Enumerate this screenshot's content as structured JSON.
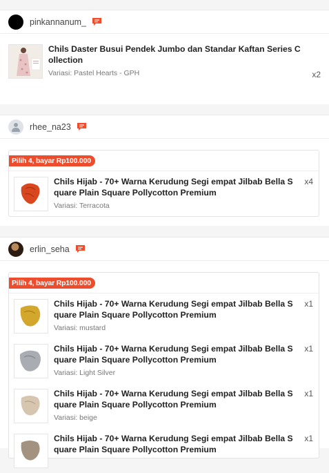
{
  "orders": [
    {
      "username": "pinkannanum_",
      "items": [
        {
          "name": "Chils Daster Busui Pendek Jumbo dan Standar Kaftan Series Collection",
          "variation": "Variasi: Pastel Hearts - GPH",
          "qty": "x2"
        }
      ]
    },
    {
      "username": "rhee_na23",
      "promo": "Pilih 4, bayar Rp100.000",
      "items": [
        {
          "name": "Chils Hijab - 70+ Warna Kerudung Segi empat Jilbab Bella Square Plain Square Pollycotton Premium",
          "variation": "Variasi: Terracota",
          "qty": "x4"
        }
      ]
    },
    {
      "username": "erlin_seha",
      "promo": "Pilih 4, bayar Rp100.000",
      "items": [
        {
          "name": "Chils Hijab - 70+ Warna Kerudung Segi empat Jilbab Bella Square Plain Square Pollycotton Premium",
          "variation": "Variasi: mustard",
          "qty": "x1"
        },
        {
          "name": "Chils Hijab - 70+ Warna Kerudung Segi empat Jilbab Bella Square Plain Square Pollycotton Premium",
          "variation": "Variasi: Light Silver",
          "qty": "x1"
        },
        {
          "name": "Chils Hijab - 70+ Warna Kerudung Segi empat Jilbab Bella Square Plain Square Pollycotton Premium",
          "variation": "Variasi: beige",
          "qty": "x1"
        },
        {
          "name": "Chils Hijab - 70+ Warna Kerudung Segi empat Jilbab Bella Square Plain Square Pollycotton Premium",
          "variation": "",
          "qty": "x1"
        }
      ]
    }
  ],
  "colors": {
    "accent": "#ee4d2d",
    "terracota": "#d9471f",
    "mustard": "#d3a72b",
    "light_silver": "#a9adb3",
    "beige": "#d6c6b0",
    "taupe": "#a39280"
  },
  "icons": {
    "chat": "chat-icon",
    "avatar_default": "user-icon"
  }
}
